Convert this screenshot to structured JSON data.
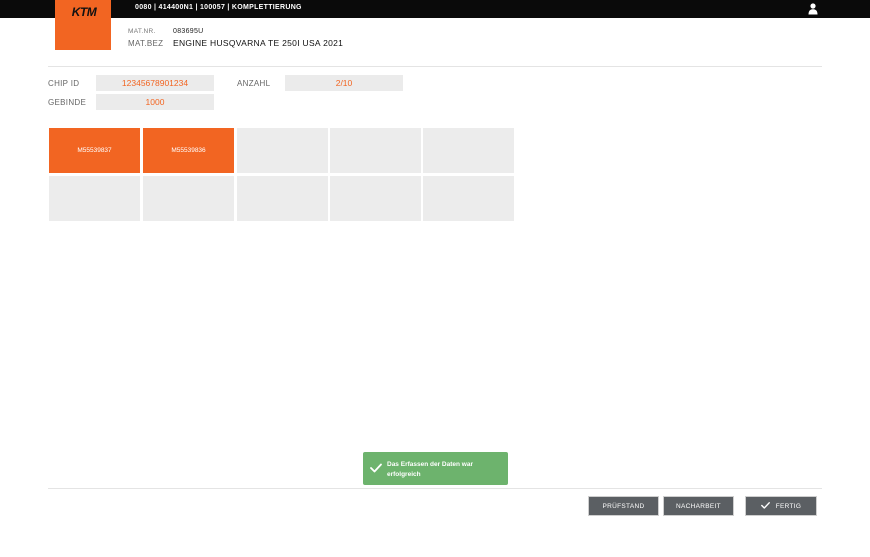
{
  "header": {
    "logo_text": "KTM",
    "path": "0080 | 414400N1 | 100057 | KOMPLETTIERUNG",
    "user_icon": "user-icon"
  },
  "material": {
    "nr_label": "MAT.NR.",
    "nr_value": "083695U",
    "bez_label": "MAT.BEZ",
    "bez_value": "ENGINE HUSQVARNA TE 250I USA 2021"
  },
  "fields": {
    "chip_id_label": "CHIP ID",
    "chip_id_value": "12345678901234",
    "anzahl_label": "ANZAHL",
    "anzahl_value": "2/10",
    "gebinde_label": "GEBINDE",
    "gebinde_value": "1000"
  },
  "tiles": [
    "M55539837",
    "M55539836",
    "",
    "",
    "",
    "",
    "",
    "",
    "",
    ""
  ],
  "toast": {
    "message": "Das Erfassen der Daten war erfolgreich",
    "icon": "check-icon",
    "color": "#6db36d"
  },
  "buttons": {
    "pruefstand": "PRÜFSTAND",
    "nacharbeit": "NACHARBEIT",
    "fertig": "FERTIG"
  },
  "colors": {
    "accent": "#f26522",
    "button_bg": "#5b5f63",
    "field_bg": "#ebebeb"
  }
}
